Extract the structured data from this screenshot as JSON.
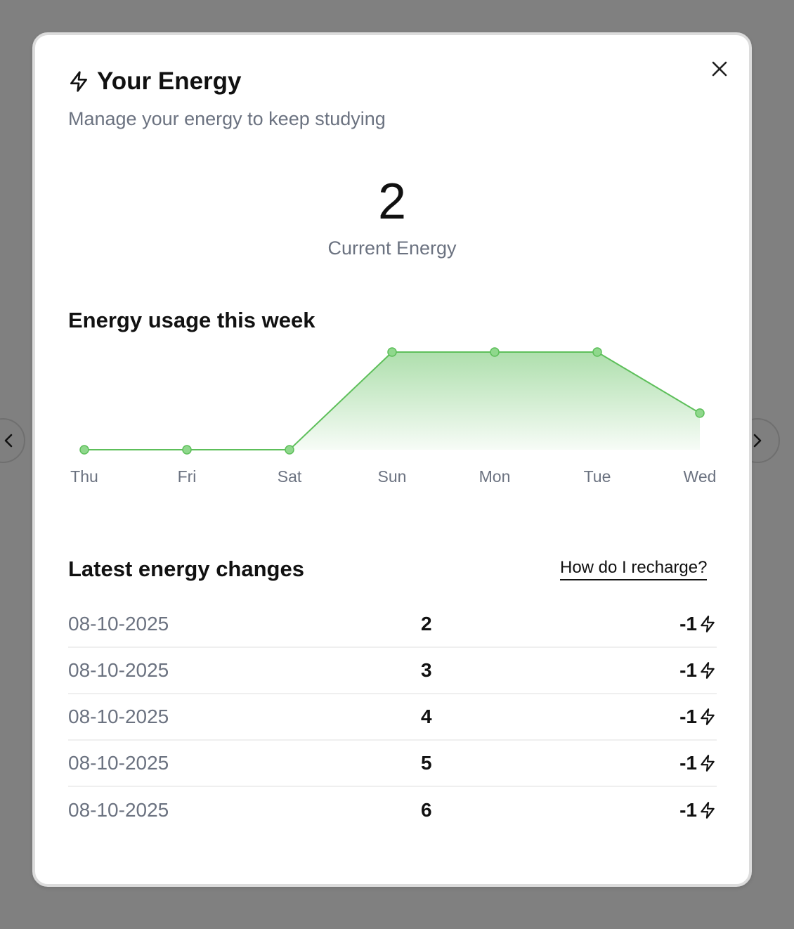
{
  "modal": {
    "title": "Your Energy",
    "subtitle": "Manage your energy to keep studying",
    "current_energy": "2",
    "current_energy_label": "Current Energy"
  },
  "usage_section": {
    "title": "Energy usage this week"
  },
  "chart_data": {
    "type": "area",
    "categories": [
      "Thu",
      "Fri",
      "Sat",
      "Sun",
      "Mon",
      "Tue",
      "Wed"
    ],
    "values": [
      0,
      0,
      0,
      8,
      8,
      8,
      3
    ],
    "xlabel": "",
    "ylabel": "",
    "grid": false,
    "color": "#5dbf5a"
  },
  "changes_section": {
    "title": "Latest energy changes",
    "recharge_link": "How do I recharge?",
    "rows": [
      {
        "date": "08-10-2025",
        "balance": "2",
        "delta": "-1"
      },
      {
        "date": "08-10-2025",
        "balance": "3",
        "delta": "-1"
      },
      {
        "date": "08-10-2025",
        "balance": "4",
        "delta": "-1"
      },
      {
        "date": "08-10-2025",
        "balance": "5",
        "delta": "-1"
      },
      {
        "date": "08-10-2025",
        "balance": "6",
        "delta": "-1"
      }
    ]
  },
  "icons": {
    "title_icon": "lightning-bolt-icon",
    "close_icon": "close-icon",
    "delta_icon": "lightning-bolt-icon",
    "prev_icon": "chevron-left-icon",
    "next_icon": "chevron-right-icon"
  }
}
